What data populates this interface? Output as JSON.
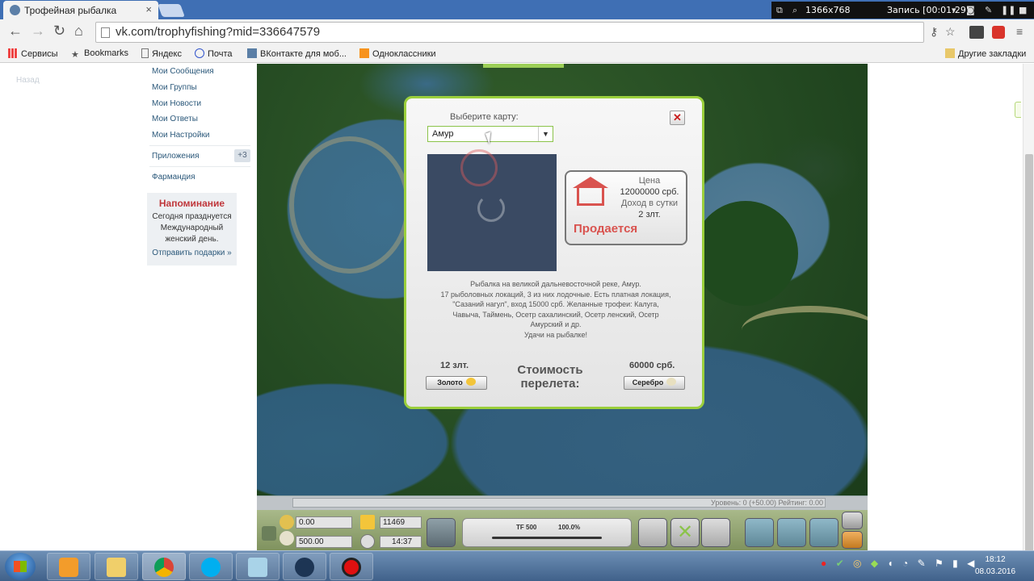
{
  "browser": {
    "tab_title": "Трофейная рыбалка",
    "tab_close": "×",
    "url": "vk.com/trophyfishing?mid=336647579",
    "recorder": {
      "resolution": "1366x768",
      "status": "Запись [00:01:29]"
    },
    "bookmarks": [
      {
        "label": "Сервисы",
        "icon": "apps-grid-icon"
      },
      {
        "label": "Bookmarks",
        "icon": "star-icon"
      },
      {
        "label": "Яндекс",
        "icon": "page-icon"
      },
      {
        "label": "Почта",
        "icon": "mail-icon"
      },
      {
        "label": "ВКонтакте для моб...",
        "icon": "vk-icon"
      },
      {
        "label": "Одноклассники",
        "icon": "ok-icon"
      }
    ],
    "other_bookmarks": "Другие закладки"
  },
  "vk": {
    "back": "Назад",
    "menu": [
      "Мои Сообщения",
      "Мои Группы",
      "Мои Новости",
      "Мои Ответы",
      "Мои Настройки"
    ],
    "apps": "Приложения",
    "apps_badge": "+3",
    "farm": "Фармандия",
    "reminder": {
      "title": "Напоминание",
      "line1": "Сегодня празднуется",
      "line2": "Международный",
      "line3": "женский день.",
      "link": "Отправить подарки »"
    }
  },
  "dialog": {
    "select_label": "Выберите карту:",
    "selected_map": "Амур",
    "price_label": "Цена",
    "price_value": "12000000 срб.",
    "income_label": "Доход в сутки",
    "income_value": "2 злт.",
    "for_sale": "Продается",
    "description": [
      "Рыбалка на великой дальневосточной реке, Амур.",
      "17 рыболовных локаций, 3 из них лодочные. Есть платная локация,",
      "\"Сазаний нагул\", вход 15000 срб. Желанные трофеи: Калуга,",
      "Чавыча, Таймень, Осетр сахалинский, Осетр ленский, Осетр",
      "Амурский и др.",
      "Удачи на рыбалке!"
    ],
    "gold_price": "12 злт.",
    "gold_button": "Золото",
    "flight_cost_line1": "Стоимость",
    "flight_cost_line2": "перелета:",
    "silver_price": "60000 срб.",
    "silver_button": "Серебро"
  },
  "hud": {
    "level": "Уровень: 0 (+50.00)  Рейтинг: 0.00",
    "gold": "0.00",
    "silver": "500.00",
    "energy": "11469",
    "time": "14:37",
    "rod_name": "TF 500",
    "rod_condition_percent": 100
  },
  "rod_condition_text": "100.0%",
  "taskbar": {
    "time": "18:12",
    "date": "08.03.2016"
  },
  "colors": {
    "accent_green": "#9bcf3c",
    "vk_link": "#2b587a",
    "sale_red": "#d9534f",
    "tabbar_blue": "#3f6fb4"
  }
}
